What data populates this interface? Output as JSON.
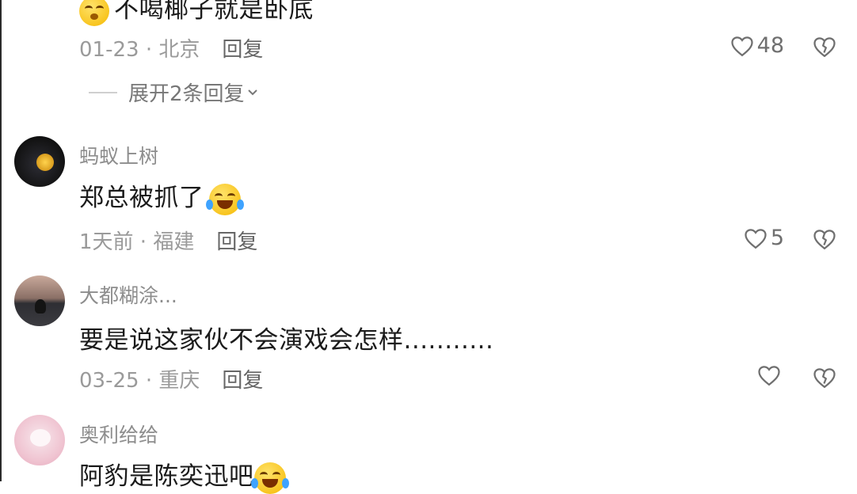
{
  "comments": [
    {
      "text": "不喝椰子就是卧底",
      "date": "01-23 · 北京",
      "reply": "回复",
      "likes": "48",
      "expand": "展开2条回复"
    },
    {
      "username": "蚂蚁上树",
      "text": "郑总被抓了",
      "date": "1天前 · 福建",
      "reply": "回复",
      "likes": "5"
    },
    {
      "username": "大都糊涂...",
      "text": "要是说这家伙不会演戏会怎样...........",
      "date": "03-25 · 重庆",
      "reply": "回复",
      "likes": ""
    },
    {
      "username": "奥利给给",
      "text": "阿豹是陈奕迅吧"
    }
  ],
  "icons": {
    "like": "heart-outline-icon",
    "dislike": "broken-heart-icon",
    "emoji": "laughing-crying-emoji-icon",
    "expand": "chevron-down-icon"
  },
  "colors": {
    "text": "#1b1b1b",
    "meta": "#9a9a9a",
    "username": "#8d8d8d"
  }
}
